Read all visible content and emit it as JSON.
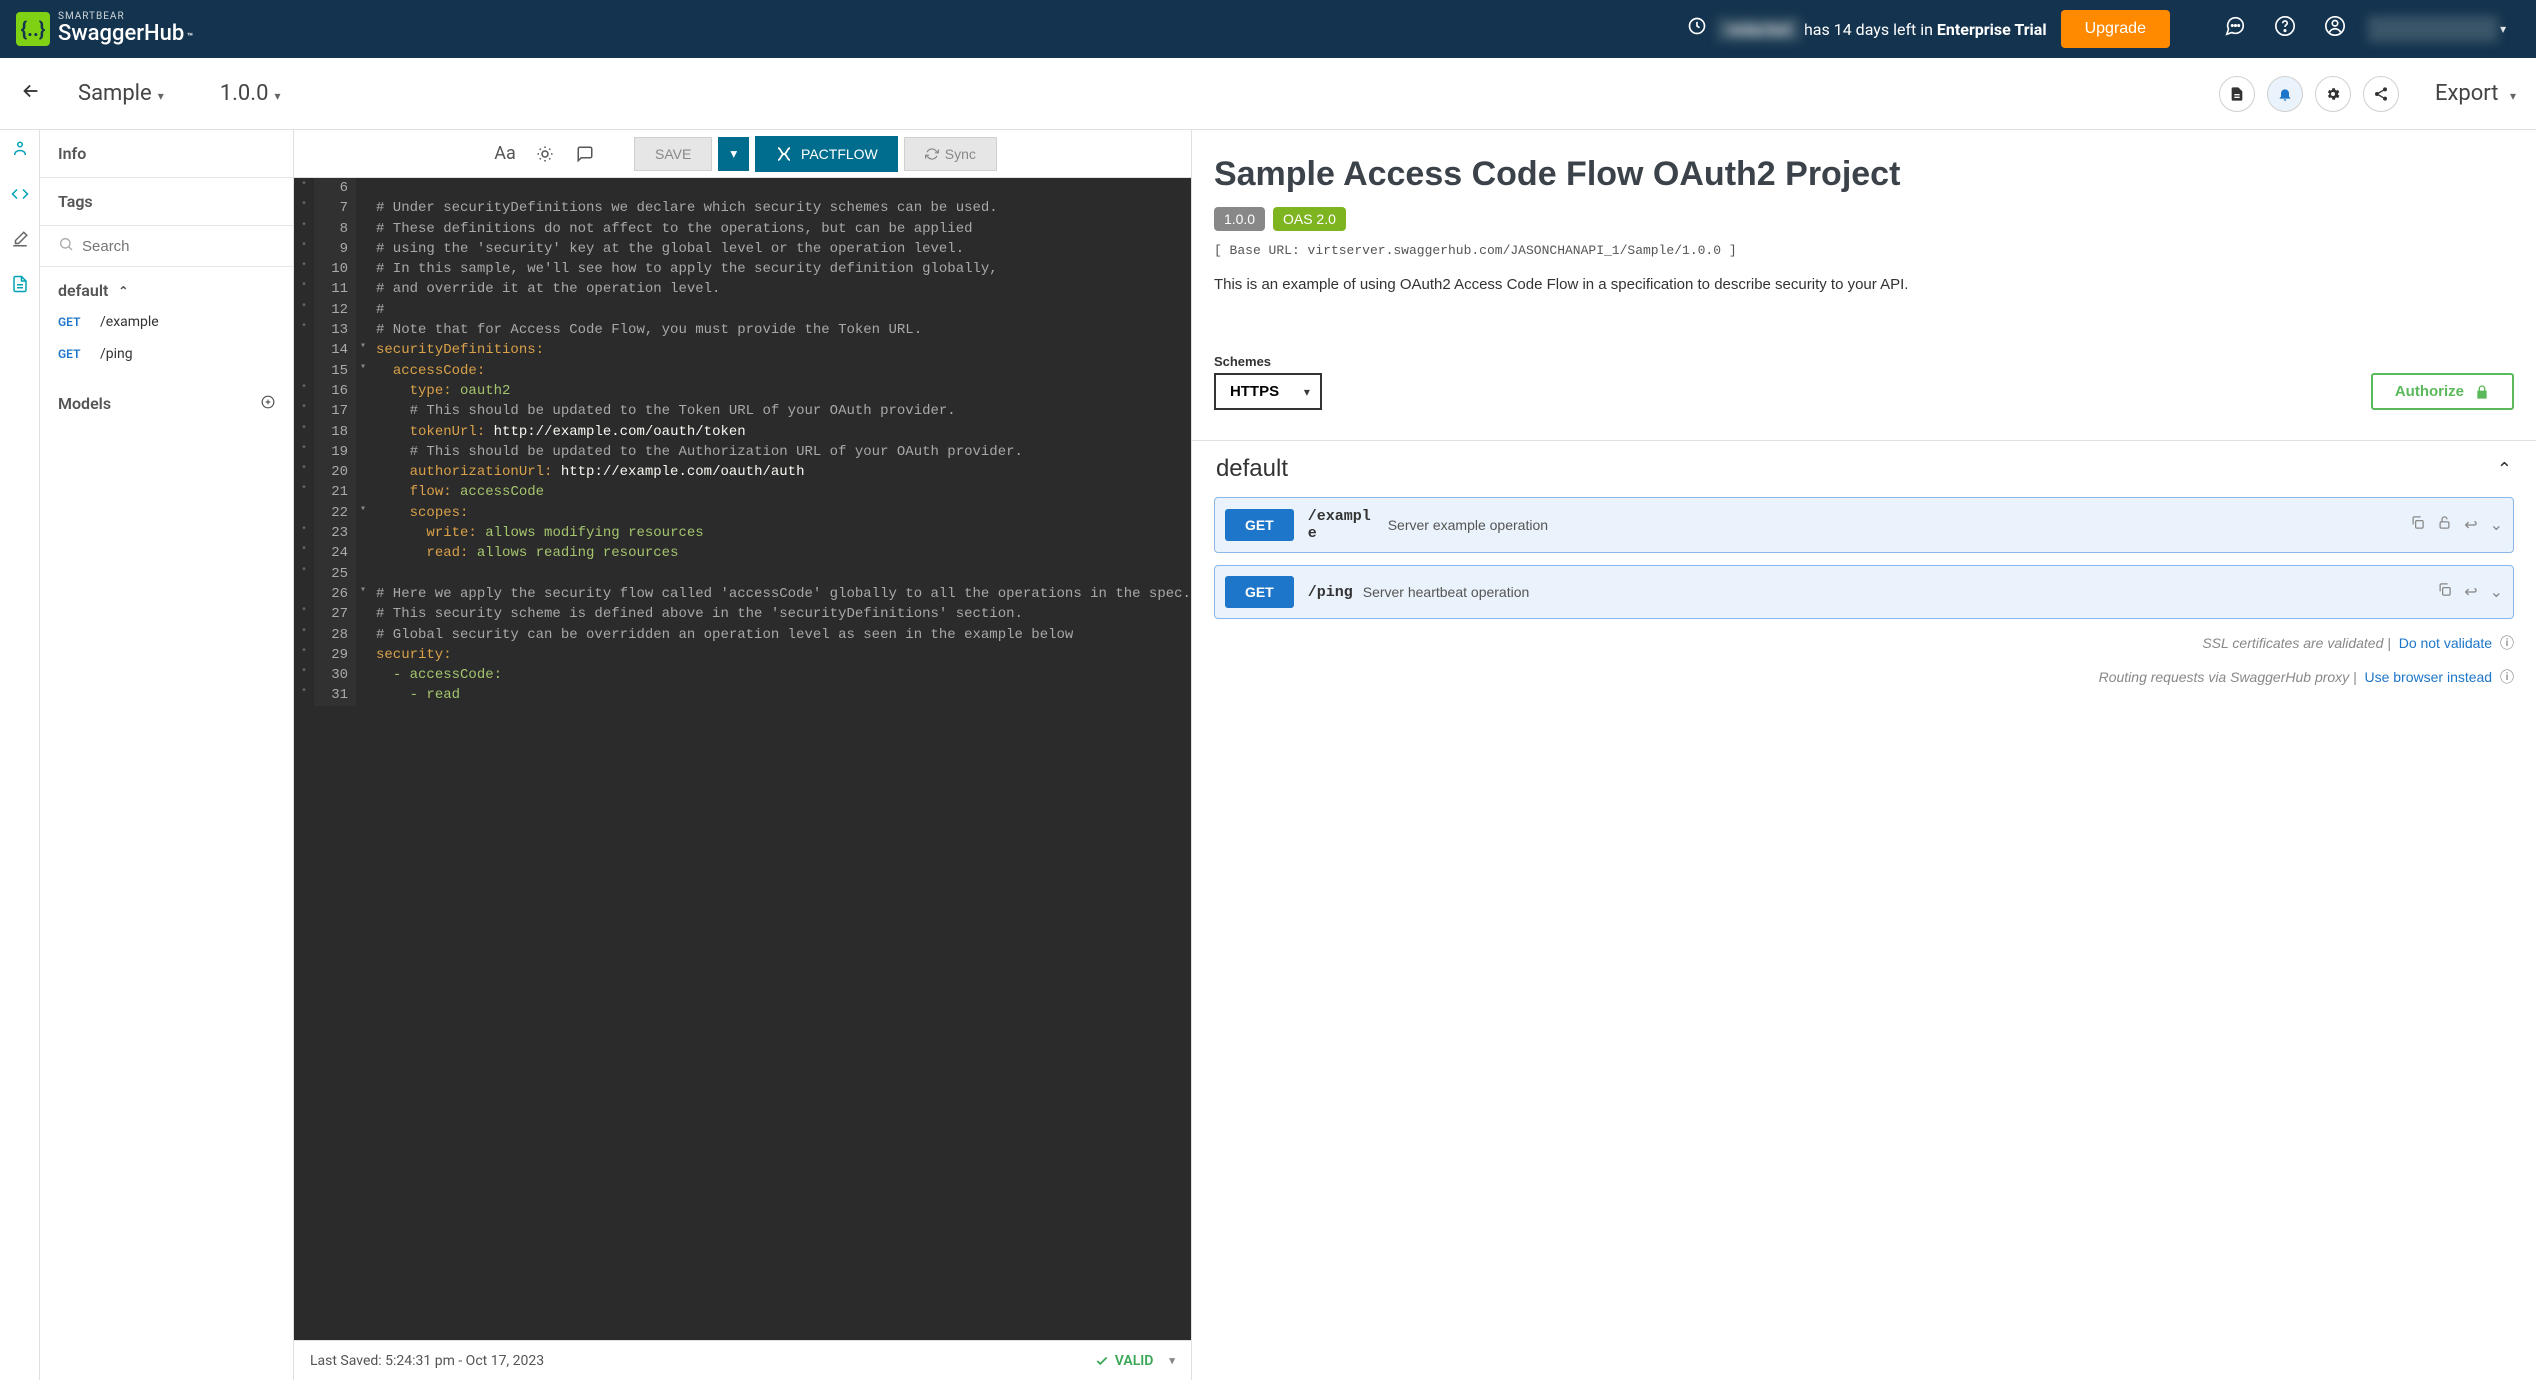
{
  "topbar": {
    "brand_small": "SMARTBEAR",
    "product": "SwaggerHub",
    "org_blur": "redacted",
    "trial_prefix": " has 14 days left in ",
    "trial_name": "Enterprise Trial",
    "upgrade": "Upgrade"
  },
  "subheader": {
    "api_name": "Sample",
    "version": "1.0.0",
    "export": "Export"
  },
  "sidebar": {
    "info": "Info",
    "tags": "Tags",
    "search_placeholder": "Search",
    "group": "default",
    "endpoints": [
      {
        "method": "GET",
        "path": "/example"
      },
      {
        "method": "GET",
        "path": "/ping"
      }
    ],
    "models": "Models"
  },
  "editor_toolbar": {
    "save": "SAVE",
    "pactflow": "PACTFLOW",
    "sync": "Sync"
  },
  "editor_lines": {
    "start": 6,
    "fold_at": [
      14,
      15,
      22,
      26
    ],
    "dots_at": [
      6,
      7,
      8,
      9,
      10,
      11,
      12,
      13,
      16,
      17,
      18,
      19,
      20,
      21,
      23,
      24,
      25,
      27,
      28,
      29,
      30,
      31
    ],
    "rows": [
      {
        "n": 6,
        "html": ""
      },
      {
        "n": 7,
        "html": "<span class='c-comment'># Under securityDefinitions we declare which security schemes can be used.</span>"
      },
      {
        "n": 8,
        "html": "<span class='c-comment'># These definitions do not affect to the operations, but can be applied</span>"
      },
      {
        "n": 9,
        "html": "<span class='c-comment'># using the 'security' key at the global level or the operation level.</span>"
      },
      {
        "n": 10,
        "html": "<span class='c-comment'># In this sample, we'll see how to apply the security definition globally,</span>"
      },
      {
        "n": 11,
        "html": "<span class='c-comment'># and override it at the operation level.</span>"
      },
      {
        "n": 12,
        "html": "<span class='c-comment'>#</span>"
      },
      {
        "n": 13,
        "html": "<span class='c-comment'># Note that for Access Code Flow, you must provide the Token URL.</span>"
      },
      {
        "n": 14,
        "html": "<span class='c-key'>securityDefinitions:</span>"
      },
      {
        "n": 15,
        "html": "  <span class='c-key'>accessCode:</span>"
      },
      {
        "n": 16,
        "html": "    <span class='c-key'>type:</span> <span class='c-val'>oauth2</span>"
      },
      {
        "n": 17,
        "html": "    <span class='c-comment'># This should be updated to the Token URL of your OAuth provider.</span>"
      },
      {
        "n": 18,
        "html": "    <span class='c-key'>tokenUrl:</span> <span class='c-url'>http://example.com/oauth/token</span>"
      },
      {
        "n": 19,
        "html": "    <span class='c-comment'># This should be updated to the Authorization URL of your OAuth provider.</span>"
      },
      {
        "n": 20,
        "html": "    <span class='c-key'>authorizationUrl:</span> <span class='c-url'>http://example.com/oauth/auth</span>"
      },
      {
        "n": 21,
        "html": "    <span class='c-key'>flow:</span> <span class='c-val'>accessCode</span>"
      },
      {
        "n": 22,
        "html": "    <span class='c-key'>scopes:</span>"
      },
      {
        "n": 23,
        "html": "      <span class='c-key'>write:</span> <span class='c-val'>allows modifying resources</span>"
      },
      {
        "n": 24,
        "html": "      <span class='c-key'>read:</span> <span class='c-val'>allows reading resources</span>"
      },
      {
        "n": 25,
        "html": ""
      },
      {
        "n": 26,
        "html": "<span class='c-comment'># Here we apply the security flow called 'accessCode' globally to all the operations in the spec.</span>"
      },
      {
        "n": 27,
        "html": "<span class='c-comment'># This security scheme is defined above in the 'securityDefinitions' section.</span>"
      },
      {
        "n": 28,
        "html": "<span class='c-comment'># Global security can be overridden an operation level as seen in the example below</span>"
      },
      {
        "n": 29,
        "html": "<span class='c-key'>security:</span>"
      },
      {
        "n": 30,
        "html": "  <span class='c-val'>- accessCode:</span>"
      },
      {
        "n": 31,
        "html": "    <span class='c-val'>- read</span>"
      }
    ]
  },
  "editor_status": {
    "saved": "Last Saved:  5:24:31 pm   -   Oct 17, 2023",
    "valid": "VALID"
  },
  "docs": {
    "title": "Sample Access Code Flow OAuth2 Project",
    "version": "1.0.0",
    "oas": "OAS 2.0",
    "base_url": "[ Base URL: virtserver.swaggerhub.com/JASONCHANAPI_1/Sample/1.0.0 ]",
    "description": "This is an example of using OAuth2 Access Code Flow in a specification to describe security to your API.",
    "schemes_label": "Schemes",
    "scheme": "HTTPS",
    "authorize": "Authorize",
    "tag_name": "default",
    "operations": [
      {
        "method": "GET",
        "path": "/example",
        "summary": "Server example operation",
        "lock": true
      },
      {
        "method": "GET",
        "path": "/ping",
        "summary": "Server heartbeat operation",
        "lock": false
      }
    ],
    "footer1_pre": "SSL certificates are validated",
    "footer1_link": "Do not validate",
    "footer2_pre": "Routing requests via SwaggerHub proxy",
    "footer2_link": "Use browser instead"
  }
}
